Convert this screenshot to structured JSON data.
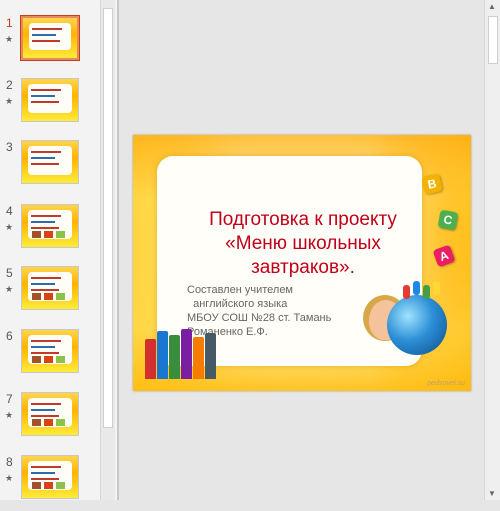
{
  "thumbnails": [
    {
      "number": "1",
      "selected": true,
      "starred": true
    },
    {
      "number": "2",
      "selected": false,
      "starred": true
    },
    {
      "number": "3",
      "selected": false,
      "starred": false
    },
    {
      "number": "4",
      "selected": false,
      "starred": true
    },
    {
      "number": "5",
      "selected": false,
      "starred": true
    },
    {
      "number": "6",
      "selected": false,
      "starred": false
    },
    {
      "number": "7",
      "selected": false,
      "starred": true
    },
    {
      "number": "8",
      "selected": false,
      "starred": true
    }
  ],
  "star_glyph": "★",
  "slide": {
    "title": "Подготовка к проекту «Меню школьных завтраков».",
    "author_lines": [
      "Составлен учителем",
      "  английского языка",
      "МБОУ СОШ №28 ст. Тамань",
      "Романенко Е.Ф."
    ],
    "watermark": "pedsovet.su",
    "blocks": [
      "B",
      "C",
      "A"
    ]
  },
  "colors": {
    "title": "#c0001a",
    "accent": "#c43e1c"
  }
}
